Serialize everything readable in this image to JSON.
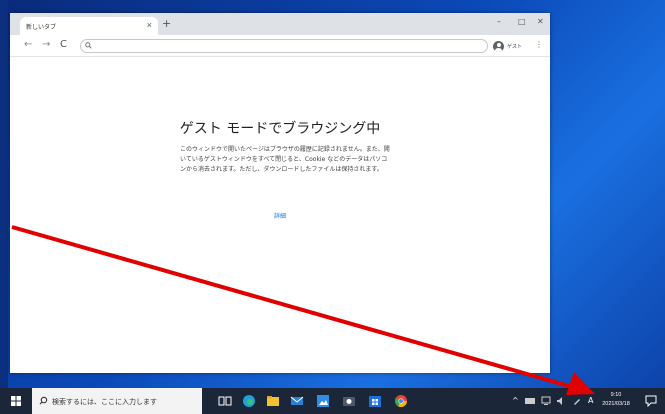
{
  "browser": {
    "tab_title": "新しいタブ",
    "tab_close": "×",
    "new_tab": "+",
    "window_controls": {
      "minimize": "–",
      "maximize": "□",
      "close": "✕"
    },
    "nav": {
      "back": "←",
      "forward": "→",
      "reload": "C"
    },
    "omnibox_placeholder": "",
    "profile_label": "ゲスト",
    "menu": "⋮"
  },
  "page": {
    "heading": "ゲスト モードでブラウジング中",
    "description": "このウィンドウで開いたページはブラウザの履歴に記録されません。また、開いているゲストウィンドウをすべて閉じると、Cookie などのデータはパソコンから消去されます。ただし、ダウンロードしたファイルは保持されます。",
    "more_link": "詳細"
  },
  "taskbar": {
    "search_placeholder": "検索するには、ここに入力します",
    "tray": {
      "chevron": "^",
      "ime": "A"
    },
    "clock": {
      "time": "9:10",
      "date": "2021/03/18"
    }
  },
  "colors": {
    "arrow": "#e00000",
    "link": "#1a73e8",
    "taskbar": "#1b2638"
  }
}
